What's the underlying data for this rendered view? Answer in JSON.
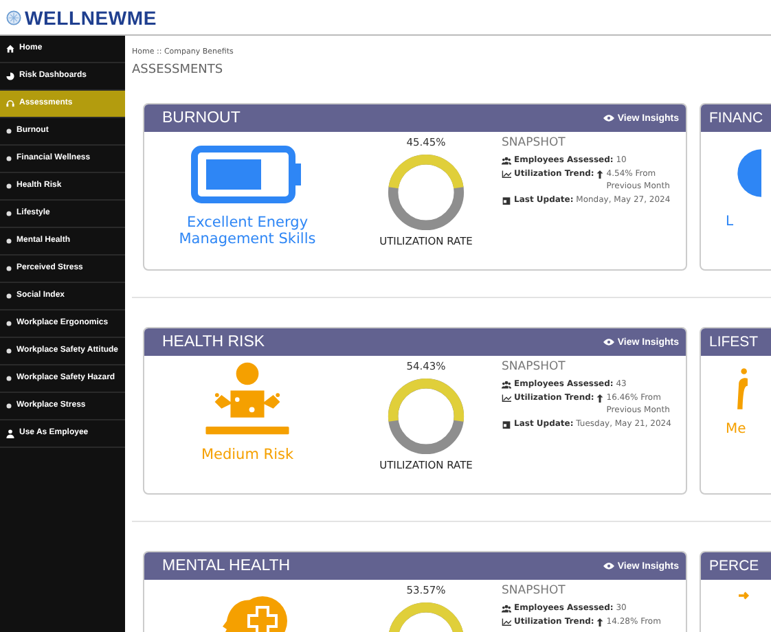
{
  "header": {
    "logo": "WELLNEWME"
  },
  "sidebar": {
    "items": [
      {
        "label": "Home",
        "selected": false
      },
      {
        "label": "Risk Dashboards",
        "selected": false
      },
      {
        "label": "Assessments",
        "selected": true
      },
      {
        "label": "Burnout",
        "selected": false
      },
      {
        "label": "Financial Wellness",
        "selected": false
      },
      {
        "label": "Health Risk",
        "selected": false
      },
      {
        "label": "Lifestyle",
        "selected": false
      },
      {
        "label": "Mental Health",
        "selected": false
      },
      {
        "label": "Perceived Stress",
        "selected": false
      },
      {
        "label": "Social Index",
        "selected": false
      },
      {
        "label": "Workplace Ergonomics",
        "selected": false
      },
      {
        "label": "Workplace Safety Attitude",
        "selected": false
      },
      {
        "label": "Workplace Safety Hazard",
        "selected": false
      },
      {
        "label": "Workplace Stress",
        "selected": false
      },
      {
        "label": "Use As Employee",
        "selected": false
      }
    ]
  },
  "breadcrumb": "Home :: Company Benefits",
  "page_title": "ASSESSMENTS",
  "rows": [
    {
      "card": {
        "title": "BURNOUT",
        "action": "View Insights",
        "kind": "battery",
        "label": "Excellent Energy Management Skills",
        "rate": "45.45%",
        "rate_label": "UTILIZATION RATE",
        "snapshot_title": "SNAPSHOT",
        "employees_label": "Employees Assessed:",
        "employees": "10",
        "trend_label": "Utilization Trend:",
        "trend": "4.54% From Previous Month",
        "update_label": "Last Update:",
        "update": "Monday, May 27, 2024"
      },
      "side_card": {
        "title": "FINANC",
        "kind": "circle",
        "label": "L"
      }
    },
    {
      "card": {
        "title": "HEALTH RISK",
        "action": "View Insights",
        "kind": "person",
        "label": "Medium Risk",
        "rate": "54.43%",
        "rate_label": "UTILIZATION RATE",
        "snapshot_title": "SNAPSHOT",
        "employees_label": "Employees Assessed:",
        "employees": "43",
        "trend_label": "Utilization Trend:",
        "trend": "16.46% From Previous Month",
        "update_label": "Last Update:",
        "update": "Tuesday, May 21, 2024"
      },
      "side_card": {
        "title": "LIFEST",
        "kind": "figure",
        "label": "Me"
      }
    },
    {
      "card": {
        "title": "MENTAL HEALTH",
        "action": "View Insights",
        "kind": "head",
        "rate": "53.57%",
        "snapshot_title": "SNAPSHOT",
        "employees_label": "Employees Assessed:",
        "employees": "30",
        "trend_label": "Utilization Trend:",
        "trend": "14.28% From"
      },
      "side_card": {
        "title": "PERCE",
        "kind": "arrow"
      }
    }
  ]
}
